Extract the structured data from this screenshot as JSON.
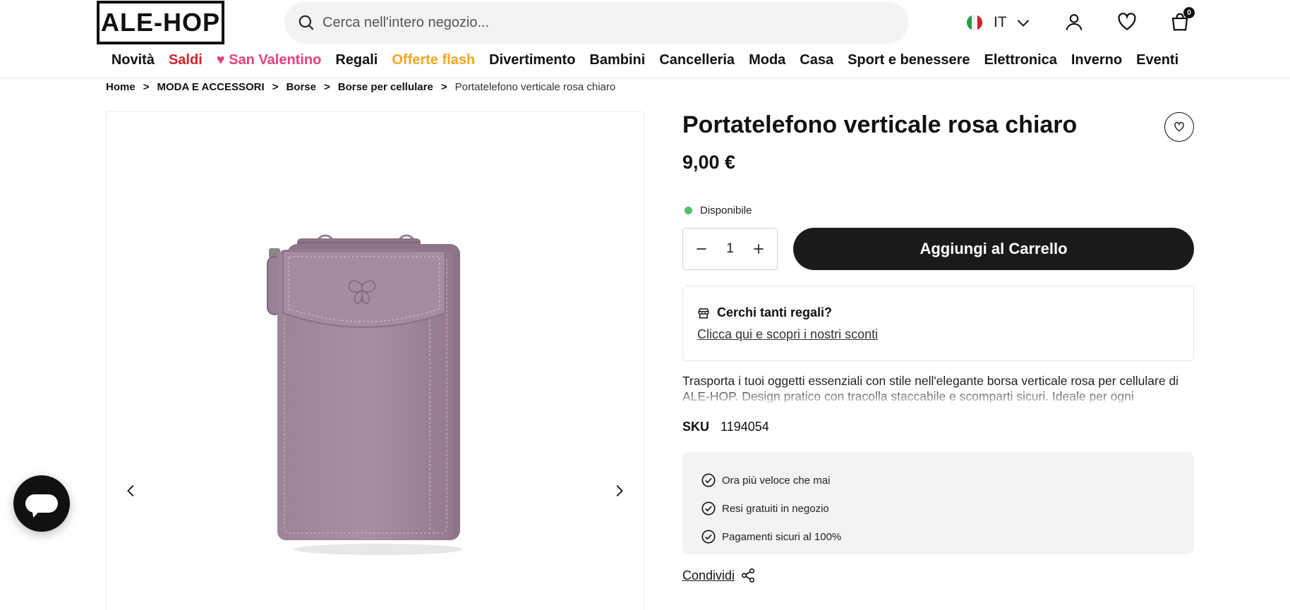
{
  "header": {
    "logo": "ALE-HOP",
    "search_placeholder": "Cerca nell'intero negozio...",
    "language": "IT",
    "cart_count": "0"
  },
  "nav": [
    {
      "label": "Novità",
      "style": "normal"
    },
    {
      "label": "Saldi",
      "style": "red"
    },
    {
      "label": "♥ San Valentino",
      "style": "pink"
    },
    {
      "label": "Regali",
      "style": "normal"
    },
    {
      "label": "Offerte flash",
      "style": "orange"
    },
    {
      "label": "Divertimento",
      "style": "normal"
    },
    {
      "label": "Bambini",
      "style": "normal"
    },
    {
      "label": "Cancelleria",
      "style": "normal"
    },
    {
      "label": "Moda",
      "style": "normal"
    },
    {
      "label": "Casa",
      "style": "normal"
    },
    {
      "label": "Sport e benessere",
      "style": "normal"
    },
    {
      "label": "Elettronica",
      "style": "normal"
    },
    {
      "label": "Inverno",
      "style": "normal"
    },
    {
      "label": "Eventi",
      "style": "normal"
    }
  ],
  "breadcrumb": {
    "items": [
      "Home",
      "MODA E ACCESSORI",
      "Borse",
      "Borse per cellulare"
    ],
    "separator": ">",
    "current": "Portatelefono verticale rosa chiaro"
  },
  "product": {
    "title": "Portatelefono verticale rosa chiaro",
    "price": "9,00 €",
    "availability": "Disponibile",
    "quantity": "1",
    "add_to_cart": "Aggiungi al Carrello",
    "promo_title": "Cerchi tanti regali?",
    "promo_link": "Clicca qui e scopri i nostri sconti",
    "description": "Trasporta i tuoi oggetti essenziali con stile nell'elegante borsa verticale rosa per cellulare di ALE-HOP. Design pratico con tracolla staccabile e scomparti sicuri. Ideale per ogni occasione.",
    "sku_label": "SKU",
    "sku": "1194054",
    "perks": [
      "Ora più veloce che mai",
      "Resi gratuiti in negozio",
      "Pagamenti sicuri al 100%"
    ],
    "share": "Condividi",
    "color": "#a48a9f"
  },
  "colors": {
    "available": "#4fc06f",
    "button": "#1a1a1a",
    "sale": "#d4202a",
    "valentine": "#e8407f",
    "flash": "#f5a623"
  }
}
